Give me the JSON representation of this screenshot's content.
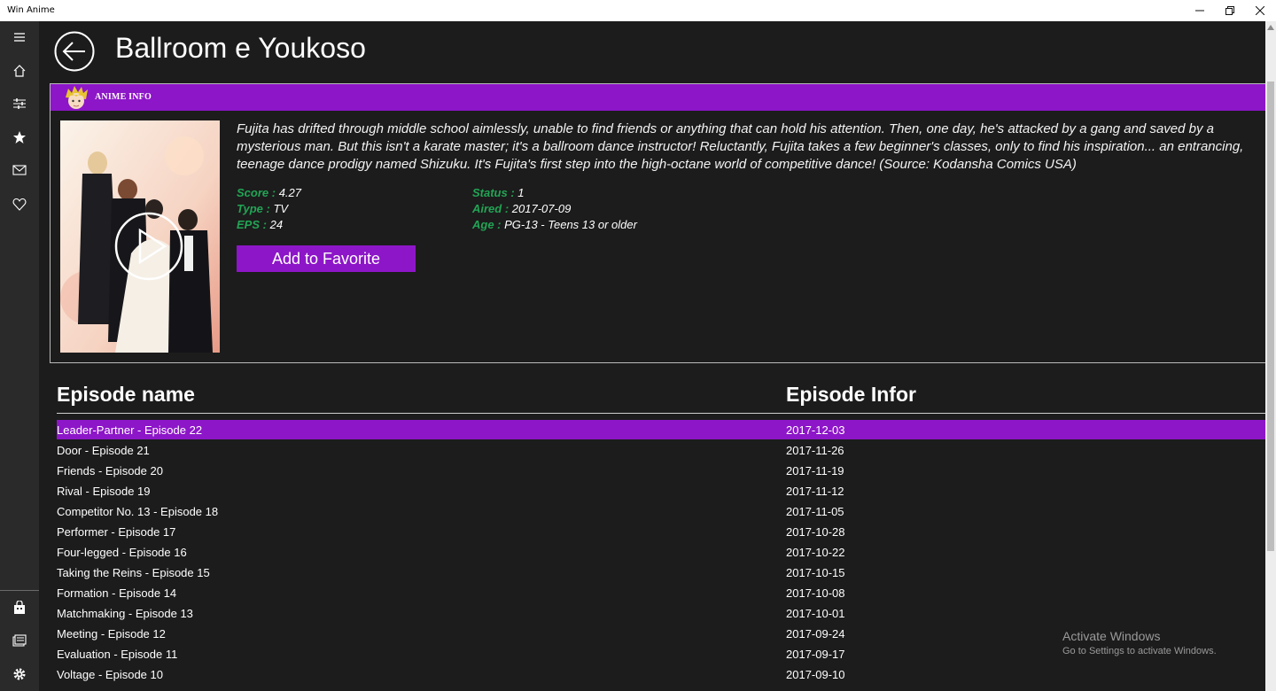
{
  "window": {
    "title": "Win Anime"
  },
  "nav": {
    "items": [
      {
        "icon": "hamburger-icon"
      },
      {
        "icon": "home-icon"
      },
      {
        "icon": "filter-icon"
      },
      {
        "icon": "star-icon"
      },
      {
        "icon": "mail-icon"
      },
      {
        "icon": "heart-icon"
      }
    ],
    "bottom": [
      {
        "icon": "store-icon"
      },
      {
        "icon": "news-icon"
      },
      {
        "icon": "settings-icon"
      }
    ]
  },
  "page": {
    "title": "Ballroom e Youkoso"
  },
  "info": {
    "header_label": "ANIME INFO",
    "synopsis": "Fujita has drifted through middle school aimlessly, unable to find friends or anything that can hold his attention. Then, one day, he's attacked by a gang and saved by a mysterious man. But this isn't a karate master; it's a ballroom dance instructor! Reluctantly, Fujita takes a few beginner's classes, only to find his inspiration... an entrancing, teenage dance prodigy named Shizuku. It's Fujita's first step into the high-octane world of competitive dance! (Source: Kodansha Comics USA)",
    "score_label": "Score :",
    "score": "4.27",
    "type_label": "Type :",
    "type": "TV",
    "eps_label": "EPS :",
    "eps": "24",
    "status_label": "Status :",
    "status": "1",
    "aired_label": "Aired :",
    "aired": "2017-07-09",
    "age_label": "Age :",
    "age": "PG-13 - Teens 13 or older",
    "favorite_button": "Add to Favorite"
  },
  "episodes": {
    "col_name": "Episode name",
    "col_info": "Episode Infor",
    "rows": [
      {
        "name": "Leader-Partner - Episode 22",
        "date": "2017-12-03"
      },
      {
        "name": "Door - Episode 21",
        "date": "2017-11-26"
      },
      {
        "name": "Friends - Episode 20",
        "date": "2017-11-19"
      },
      {
        "name": "Rival - Episode 19",
        "date": "2017-11-12"
      },
      {
        "name": "Competitor No. 13 - Episode 18",
        "date": "2017-11-05"
      },
      {
        "name": "Performer - Episode 17",
        "date": "2017-10-28"
      },
      {
        "name": "Four-legged - Episode 16",
        "date": "2017-10-22"
      },
      {
        "name": "Taking the Reins - Episode 15",
        "date": "2017-10-15"
      },
      {
        "name": "Formation - Episode 14",
        "date": "2017-10-08"
      },
      {
        "name": "Matchmaking - Episode 13",
        "date": "2017-10-01"
      },
      {
        "name": "Meeting - Episode 12",
        "date": "2017-09-24"
      },
      {
        "name": "Evaluation - Episode 11",
        "date": "2017-09-17"
      },
      {
        "name": "Voltage - Episode 10",
        "date": "2017-09-10"
      }
    ]
  },
  "watermark": {
    "line1": "Activate Windows",
    "line2": "Go to Settings to activate Windows."
  },
  "colors": {
    "accent": "#8d16c8",
    "label_green": "#23a455",
    "background": "#1c1c1c"
  }
}
